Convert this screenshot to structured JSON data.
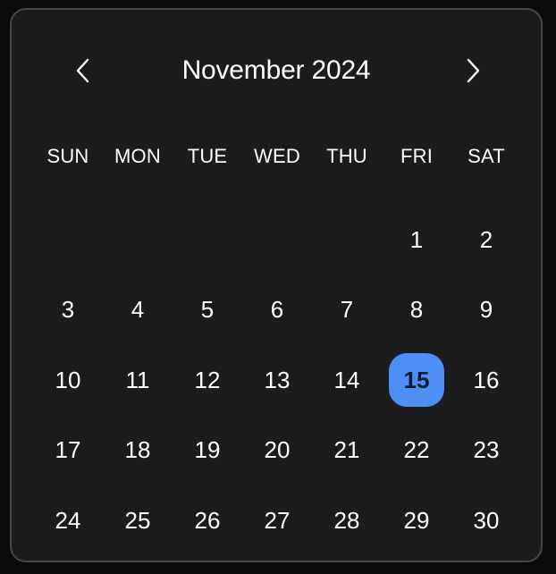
{
  "header": {
    "title": "November 2024",
    "prev_icon": "chevron-left-icon",
    "next_icon": "chevron-right-icon"
  },
  "weekdays": [
    "SUN",
    "MON",
    "TUE",
    "WED",
    "THU",
    "FRI",
    "SAT"
  ],
  "weeks": [
    [
      "",
      "",
      "",
      "",
      "",
      "1",
      "2"
    ],
    [
      "3",
      "4",
      "5",
      "6",
      "7",
      "8",
      "9"
    ],
    [
      "10",
      "11",
      "12",
      "13",
      "14",
      "15",
      "16"
    ],
    [
      "17",
      "18",
      "19",
      "20",
      "21",
      "22",
      "23"
    ],
    [
      "24",
      "25",
      "26",
      "27",
      "28",
      "29",
      "30"
    ]
  ],
  "selected_day": "15",
  "colors": {
    "background": "#1c1c1e",
    "border": "#48484c",
    "accent": "#4d8ff2",
    "text": "#ffffff"
  }
}
